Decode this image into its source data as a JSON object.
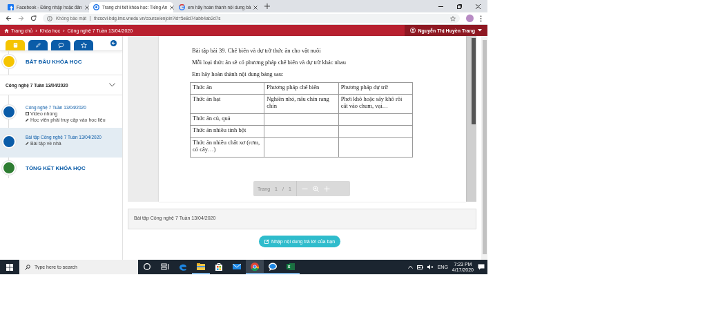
{
  "browser": {
    "tabs": [
      {
        "kind": "facebook",
        "title": "Facebook - Đăng nhập hoặc đăn",
        "selected": false
      },
      {
        "kind": "lms",
        "title": "Trang chi tiết khóa học: Tiếng An",
        "selected": true
      },
      {
        "kind": "google",
        "title": "em hãy hoàn thành nội dung bả",
        "selected": false
      }
    ],
    "security": "Không bảo mật",
    "url": "thcscvl-bdg.lms.vnedu.vn/course/enjoin?id=5e8d74abb4ab2d7s"
  },
  "nav": {
    "breadcrumbs": [
      {
        "label": "Trang chủ"
      },
      {
        "separator": "›",
        "label": "Khóa học"
      },
      {
        "separator": "›",
        "label": "Công nghệ 7 Tuần 13/04/2020"
      }
    ],
    "user": "Nguyễn Thị Huyền Trang"
  },
  "sidebar": {
    "tabs": [
      {
        "kind": "book",
        "selected": true
      },
      {
        "kind": "pencil",
        "selected": false
      },
      {
        "kind": "chat",
        "selected": false
      },
      {
        "kind": "star",
        "selected": false
      }
    ],
    "items": [
      {
        "kind": "milestone",
        "title": "BẮT ĐẦU KHÓA HỌC",
        "color": "#f5c400",
        "selected": false
      },
      {
        "kind": "section",
        "title": "Công nghệ 7 Tuần 13/04/2020",
        "expanded": true,
        "selected": false
      },
      {
        "kind": "lesson",
        "title": "Công nghệ 7 Tuần 13/04/2020",
        "color": "#0b5ca8",
        "selected": false,
        "details": [
          {
            "kind": "video",
            "text": "Video nhúng"
          },
          {
            "kind": "task",
            "text": "Học viên phải truy cập vào học liệu"
          }
        ]
      },
      {
        "kind": "lesson",
        "title": "Bài tập Công nghệ 7 Tuần 13/04/2020",
        "color": "#0b5ca8",
        "selected": true,
        "details": [
          {
            "kind": "task",
            "text": "Bài tập về nhà"
          }
        ]
      },
      {
        "kind": "milestone",
        "title": "TỔNG KẾT KHÓA HỌC",
        "color": "#2e7d32",
        "selected": false
      }
    ]
  },
  "document": {
    "lines": [
      "Bài tập bài 39. Chế biến và dự trữ thức ăn cho vật nuôi",
      "Mỗi loại thức ăn sẽ có phương pháp chế biến và dự trữ khác nhau",
      "Em hãy hoàn thành nội dung bảng sau:"
    ],
    "table": {
      "columns": [
        "Thức ăn",
        "Phương pháp chế biến",
        "Phương pháp dự trữ"
      ],
      "rows": [
        {
          "cells": [
            "Thức ăn hạt",
            "Nghiền nhỏ, nấu chín rang chín",
            "Phơi khô hoặc sấy khô rồi cất vào chum, vại…"
          ]
        },
        {
          "cells": [
            "Thức ăn củ, quả"
          ]
        },
        {
          "cells": [
            "Thức ăn nhiều tinh bột"
          ]
        },
        {
          "cells": [
            "Thức ăn nhiều chất xơ (rơm, cỏ cây…)"
          ]
        }
      ]
    },
    "pager": {
      "label": "Trang",
      "page": "1",
      "separator": "/",
      "total": "1"
    }
  },
  "info": "Bài tập Công nghệ 7 Tuần 13/04/2020",
  "answer_button": "Nhập nội dung trả lời của bạn",
  "taskbar": {
    "search": {
      "placeholder": "Type here to search"
    },
    "apps": [
      {
        "kind": "cortana",
        "running": false,
        "selected": false
      },
      {
        "kind": "taskview",
        "running": false,
        "selected": false
      },
      {
        "kind": "edge",
        "running": false,
        "selected": false
      },
      {
        "kind": "explorer",
        "running": true,
        "selected": false
      },
      {
        "kind": "store",
        "running": false,
        "selected": false
      },
      {
        "kind": "mail",
        "running": false,
        "selected": false
      },
      {
        "kind": "chrome",
        "running": true,
        "selected": true
      },
      {
        "kind": "messenger",
        "running": true,
        "selected": false
      },
      {
        "kind": "excel",
        "running": true,
        "selected": false
      }
    ],
    "language": "ENG",
    "time": "7:23 PM",
    "date": "4/17/2020"
  }
}
